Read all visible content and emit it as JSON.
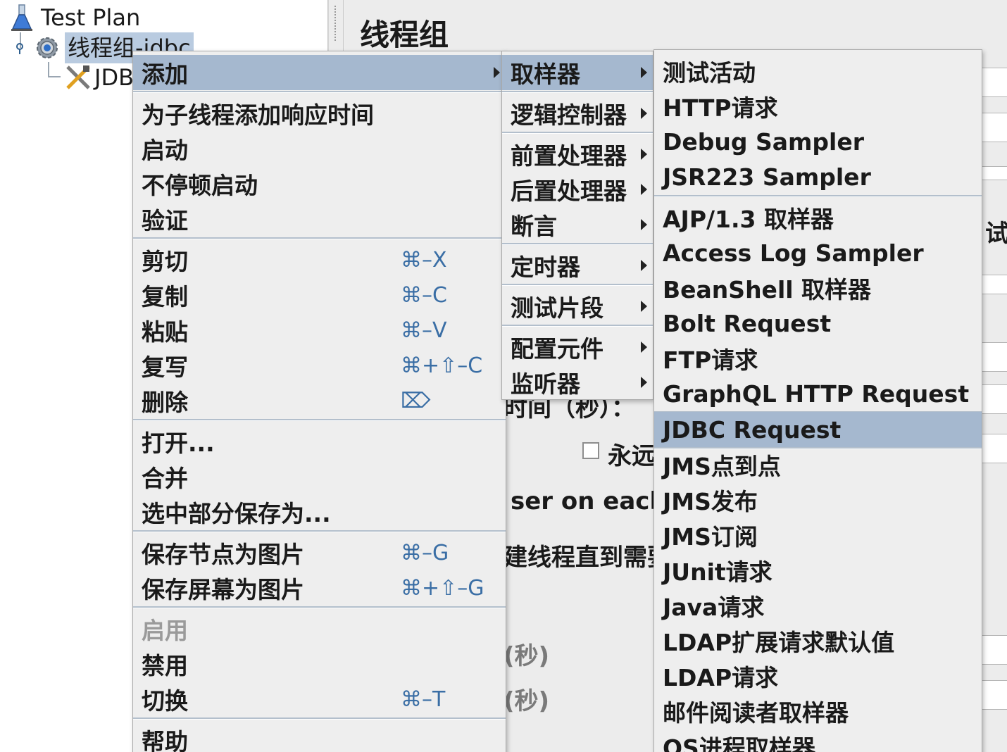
{
  "tree": {
    "root_label": "Test Plan",
    "thread_group_label": "线程组-jdbc",
    "child_label": "JDBC"
  },
  "editor": {
    "title": "线程组",
    "side_char": "试",
    "ramp_text": "时间（秒）：",
    "forever_label": "永远",
    "same_user_text": "ser on each",
    "delay_create_text": "建线程直到需要",
    "duration_text": "(秒)",
    "delay_text": "(秒)"
  },
  "context_menu": {
    "add": "添加",
    "add_response_time": "为子线程添加响应时间",
    "start": "启动",
    "start_no_pause": "不停顿启动",
    "validate": "验证",
    "cut": "剪切",
    "cut_shortcut": "⌘–X",
    "copy": "复制",
    "copy_shortcut": "⌘–C",
    "paste": "粘贴",
    "paste_shortcut": "⌘–V",
    "duplicate": "复写",
    "duplicate_shortcut": "⌘+⇧–C",
    "delete": "删除",
    "delete_shortcut": "⌦",
    "open": "打开...",
    "merge": "合并",
    "save_selection_as": "选中部分保存为...",
    "save_node_image": "保存节点为图片",
    "save_node_image_shortcut": "⌘–G",
    "save_screen_image": "保存屏幕为图片",
    "save_screen_image_shortcut": "⌘+⇧–G",
    "enable": "启用",
    "disable": "禁用",
    "toggle": "切换",
    "toggle_shortcut": "⌘–T",
    "help": "帮助"
  },
  "add_submenu": {
    "sampler": "取样器",
    "logic_controller": "逻辑控制器",
    "pre_processor": "前置处理器",
    "post_processor": "后置处理器",
    "assertion": "断言",
    "timer": "定时器",
    "test_fragment": "测试片段",
    "config_element": "配置元件",
    "listener": "监听器"
  },
  "sampler_submenu": {
    "group1": [
      "测试活动",
      "HTTP请求",
      "Debug Sampler",
      "JSR223 Sampler"
    ],
    "group2": [
      "AJP/1.3 取样器",
      "Access Log Sampler",
      "BeanShell 取样器",
      "Bolt Request",
      "FTP请求",
      "GraphQL HTTP Request",
      "JDBC Request",
      "JMS点到点",
      "JMS发布",
      "JMS订阅",
      "JUnit请求",
      "Java请求",
      "LDAP扩展请求默认值",
      "LDAP请求",
      "邮件阅读者取样器",
      "OS进程取样器"
    ],
    "highlighted": "JDBC Request"
  },
  "colors": {
    "highlight": "#a5b8cf",
    "selection": "#b9cbe0",
    "shortcut": "#3a6ea5",
    "menu_bg": "#eeeeee"
  }
}
